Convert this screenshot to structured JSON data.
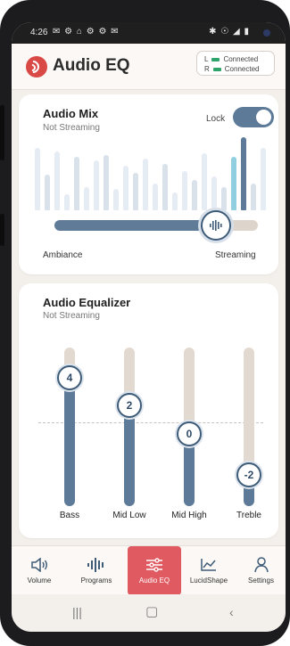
{
  "status_bar": {
    "time": "4:26",
    "notification_icons": "✉ ⚙ ⌂ ⚙ ⚙ ✉",
    "system_icons": "✱ ☉ ◢ ▮"
  },
  "header": {
    "title": "Audio EQ",
    "left_label": "L",
    "left_status": "Connected",
    "right_label": "R",
    "right_status": "Connected"
  },
  "audio_mix": {
    "title": "Audio Mix",
    "subtitle": "Not Streaming",
    "lock_label": "Lock",
    "lock_on": true,
    "left_label": "Ambiance",
    "right_label": "Streaming",
    "mix_level": 0.73
  },
  "equalizer": {
    "title": "Audio Equalizer",
    "subtitle": "Not Streaming",
    "bands": [
      {
        "label": "Bass",
        "value": "4"
      },
      {
        "label": "Mid Low",
        "value": "2"
      },
      {
        "label": "Mid High",
        "value": "0"
      },
      {
        "label": "Treble",
        "value": "-2"
      }
    ]
  },
  "nav": {
    "items": [
      {
        "label": "Volume",
        "icon": "speaker-icon"
      },
      {
        "label": "Programs",
        "icon": "waveform-icon"
      },
      {
        "label": "Audio EQ",
        "icon": "sliders-icon",
        "active": true
      },
      {
        "label": "LucidShape",
        "icon": "chart-line-icon"
      },
      {
        "label": "Settings",
        "icon": "person-icon"
      }
    ]
  },
  "colors": {
    "accent": "#5d7a98",
    "active_tab": "#e05a62",
    "connected": "#2ea46a",
    "logo": "#d94a47"
  }
}
